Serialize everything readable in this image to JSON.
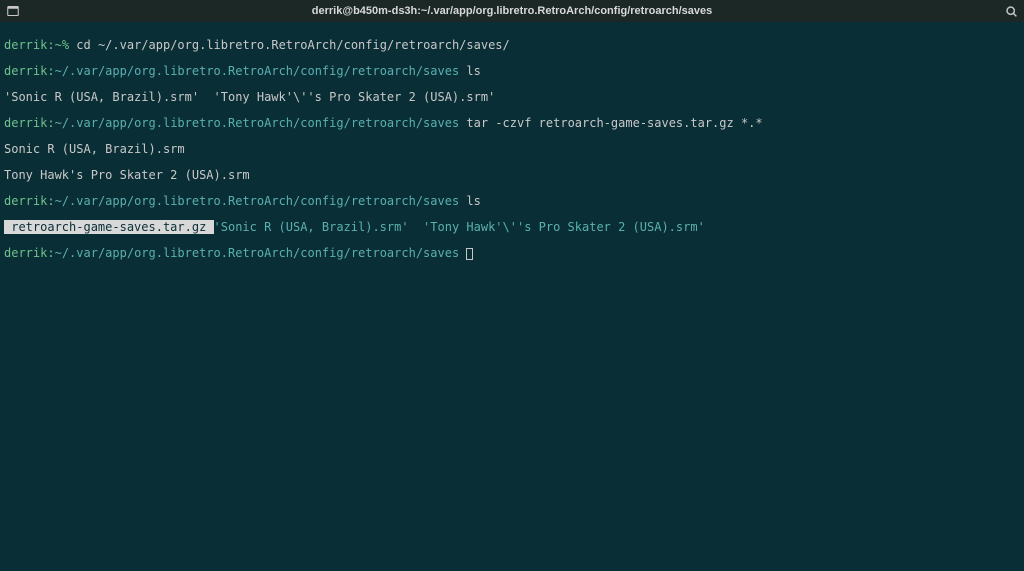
{
  "titlebar": {
    "title": "derrik@b450m-ds3h:~/.var/app/org.libretro.RetroArch/config/retroarch/saves"
  },
  "prompt": {
    "user": "derrik",
    "sep": ":",
    "tilde": "~",
    "path": "/.var/app/org.libretro.RetroArch/config/retroarch/saves",
    "symbol": "% "
  },
  "lines": {
    "l1_cmd": "cd ~/.var/app/org.libretro.RetroArch/config/retroarch/saves/",
    "l2_cmd": "ls",
    "l3_out": "'Sonic R (USA, Brazil).srm'  'Tony Hawk'\\''s Pro Skater 2 (USA).srm'",
    "l4_cmd": "tar -czvf retroarch-game-saves.tar.gz *.*",
    "l5_out": "Sonic R (USA, Brazil).srm",
    "l6_out": "Tony Hawk's Pro Skater 2 (USA).srm",
    "l7_cmd": "ls",
    "l8_hl": " retroarch-game-saves.tar.gz ",
    "l8_s1": "'Sonic R (USA, Brazil).srm'",
    "l8_gap": "  ",
    "l8_s2": "'Tony Hawk'\\''s Pro Skater 2 (USA).srm'"
  }
}
